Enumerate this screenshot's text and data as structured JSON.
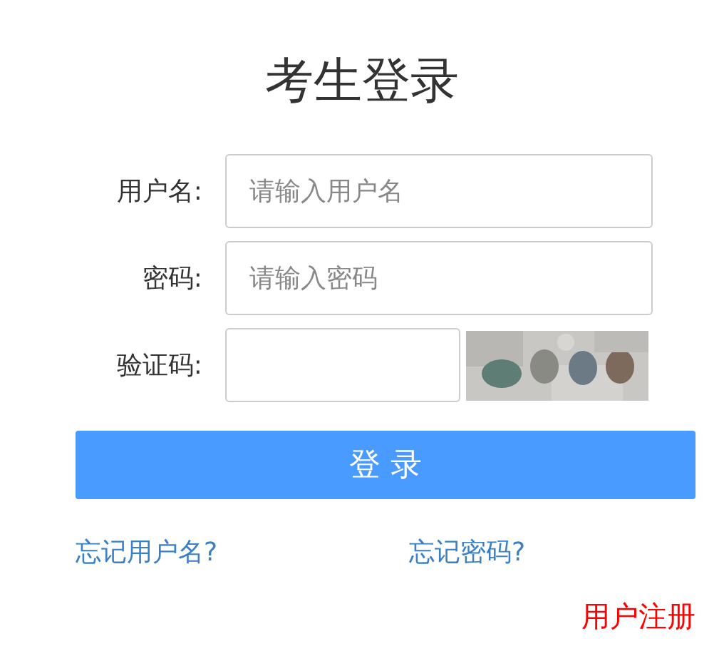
{
  "title": "考生登录",
  "fields": [
    {
      "label": "用户名:",
      "placeholder": "请输入用户名",
      "kind": "text"
    },
    {
      "label": "密码:",
      "placeholder": "请输入密码",
      "kind": "password"
    },
    {
      "label": "验证码:",
      "kind": "captcha"
    }
  ],
  "login_button": "登 录",
  "links": [
    "忘记用户名?",
    "忘记密码?"
  ],
  "register_link": "用户注册"
}
